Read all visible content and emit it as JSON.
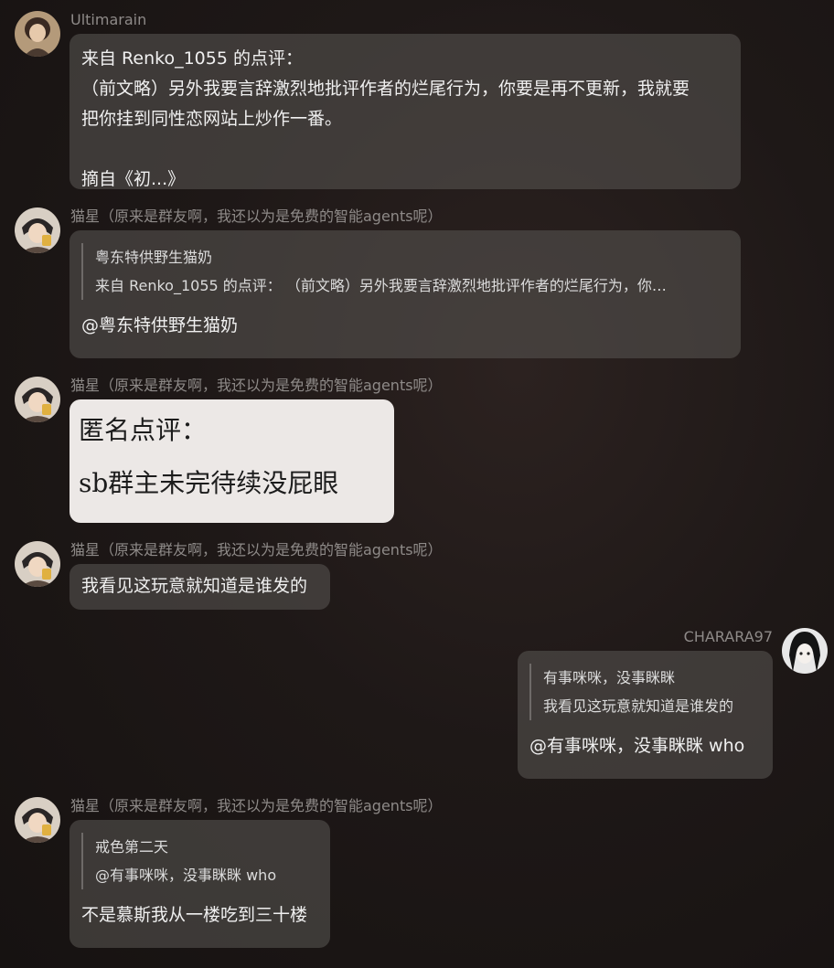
{
  "messages": [
    {
      "sender": "Ultimarain",
      "lines": [
        "来自 Renko_1055 的点评：",
        "（前文略）另外我要言辞激烈地批评作者的烂尾行为，你要是再不更新，我就要",
        "把你挂到同性恋网站上炒作一番。",
        "",
        "摘自《初...》"
      ]
    },
    {
      "sender": "猫星（原来是群友啊，我还以为是免费的智能agents呢）",
      "quote_author": "粤东特供野生猫奶",
      "quote_text": "来自 Renko_1055 的点评： （前文略）另外我要言辞激烈地批评作者的烂尾行为，你…",
      "reply": "@粤东特供野生猫奶"
    },
    {
      "sender": "猫星（原来是群友啊，我还以为是免费的智能agents呢）",
      "image_title": "匿名点评：",
      "image_body": "sb群主未完待续没屁眼"
    },
    {
      "sender": "猫星（原来是群友啊，我还以为是免费的智能agents呢）",
      "text": "我看见这玩意就知道是谁发的"
    },
    {
      "sender": "CHARARA97",
      "quote_author": "有事咪咪，没事眯眯",
      "quote_text": "我看见这玩意就知道是谁发的",
      "reply": "@有事咪咪，没事眯眯 who"
    },
    {
      "sender": "猫星（原来是群友啊，我还以为是免费的智能agents呢）",
      "quote_author": "戒色第二天",
      "quote_text": "@有事咪咪，没事眯眯 who",
      "reply": "不是慕斯我从一楼吃到三十楼"
    }
  ]
}
